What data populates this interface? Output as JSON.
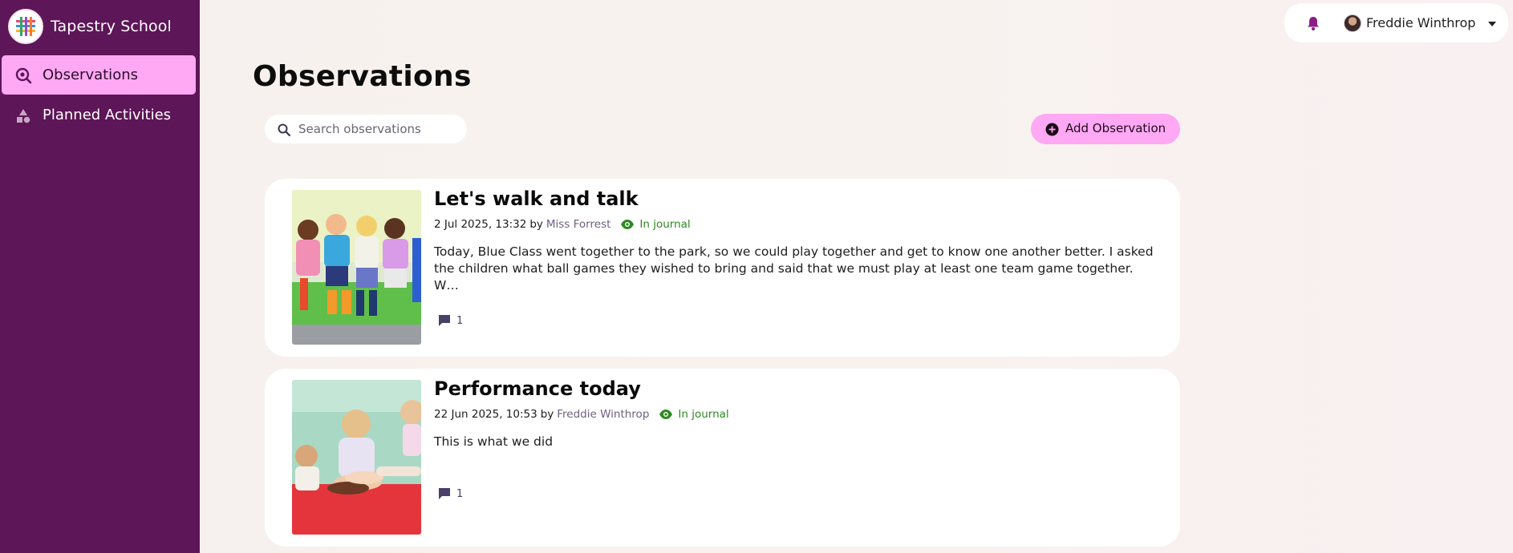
{
  "sidebar": {
    "brand": "Tapestry School",
    "items": [
      {
        "label": "Observations",
        "icon": "observations-icon",
        "active": true
      },
      {
        "label": "Planned Activities",
        "icon": "shapes-icon",
        "active": false
      }
    ]
  },
  "header": {
    "user_name": "Freddie Winthrop",
    "bell_icon": "bell-icon",
    "bell_color": "#8a1e86"
  },
  "main": {
    "title": "Observations",
    "search": {
      "placeholder": "Search observations",
      "value": ""
    },
    "add_button": {
      "label": "Add Observation",
      "color": "#ffa8f4"
    }
  },
  "observations": [
    {
      "title": "Let's walk and talk",
      "date": "2 Jul 2025, 13:32",
      "by": "by",
      "author": "Miss Forrest",
      "journal": "In journal",
      "excerpt": "Today, Blue Class went together to the park, so we could play together and get to know one another better. I asked the children what ball games they wished to bring and said that we must play at least one team game together. W…",
      "comments": "1"
    },
    {
      "title": "Performance today",
      "date": "22 Jun 2025, 10:53",
      "by": "by",
      "author": "Freddie Winthrop",
      "journal": "In journal",
      "excerpt": "This is what we did",
      "comments": "1"
    }
  ],
  "colors": {
    "sidebar_bg": "#5d1657",
    "accent_pink": "#ffa8f4",
    "journal_green": "#2e8a22",
    "author_purple": "#6f6180"
  }
}
